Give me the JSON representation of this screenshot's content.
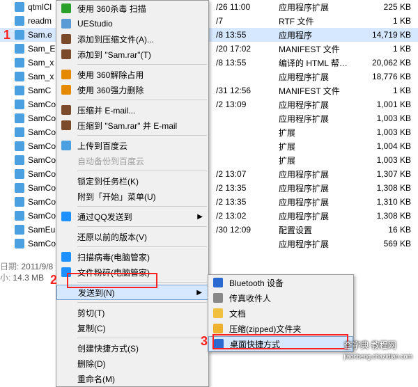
{
  "files": [
    {
      "name": "qtmlCl",
      "date": "/26 11:00",
      "type": "应用程序扩展",
      "size": "225 KB"
    },
    {
      "name": "readm",
      "date": "/7",
      "type": "RTF 文件",
      "size": "1 KB"
    },
    {
      "name": "Sam.e",
      "date": "/8 13:55",
      "type": "应用程序",
      "size": "14,719 KB",
      "sel": true
    },
    {
      "name": "Sam_E",
      "date": "/20 17:02",
      "type": "MANIFEST 文件",
      "size": "1 KB"
    },
    {
      "name": "Sam_x",
      "date": "/8 13:55",
      "type": "编译的 HTML 帮…",
      "size": "20,062 KB"
    },
    {
      "name": "Sam_x",
      "date": "",
      "type": "应用程序扩展",
      "size": "18,776 KB"
    },
    {
      "name": "SamC",
      "date": "/31 12:56",
      "type": "MANIFEST 文件",
      "size": "1 KB"
    },
    {
      "name": "SamCo",
      "date": "/2 13:09",
      "type": "应用程序扩展",
      "size": "1,001 KB"
    },
    {
      "name": "SamCo",
      "date": "",
      "type": "应用程序扩展",
      "size": "1,003 KB"
    },
    {
      "name": "SamCo",
      "date": "",
      "type": "扩展",
      "size": "1,003 KB"
    },
    {
      "name": "SamCo",
      "date": "",
      "type": "扩展",
      "size": "1,004 KB"
    },
    {
      "name": "SamCo",
      "date": "",
      "type": "扩展",
      "size": "1,003 KB"
    },
    {
      "name": "SamCo",
      "date": "/2 13:07",
      "type": "应用程序扩展",
      "size": "1,307 KB"
    },
    {
      "name": "SamCo",
      "date": "/2 13:35",
      "type": "应用程序扩展",
      "size": "1,308 KB"
    },
    {
      "name": "SamCo",
      "date": "/2 13:35",
      "type": "应用程序扩展",
      "size": "1,310 KB"
    },
    {
      "name": "SamCo",
      "date": "/2 13:02",
      "type": "应用程序扩展",
      "size": "1,308 KB"
    },
    {
      "name": "SamEu",
      "date": "/30 12:09",
      "type": "配置设置",
      "size": "16 KB"
    },
    {
      "name": "SamCo",
      "date": "",
      "type": "应用程序扩展",
      "size": "569 KB"
    }
  ],
  "menu1": [
    {
      "label": "使用 360杀毒 扫描",
      "icon": "shield"
    },
    {
      "label": "UEStudio",
      "icon": "ue"
    },
    {
      "label": "添加到压缩文件(A)...",
      "icon": "rar"
    },
    {
      "label": "添加到 \"Sam.rar\"(T)",
      "icon": "rar"
    },
    {
      "sep": true
    },
    {
      "label": "使用 360解除占用",
      "icon": "360"
    },
    {
      "label": "使用 360强力删除",
      "icon": "360"
    },
    {
      "sep": true
    },
    {
      "label": "压缩并 E-mail...",
      "icon": "rar"
    },
    {
      "label": "压缩到 \"Sam.rar\" 并 E-mail",
      "icon": "rar"
    },
    {
      "sep": true
    },
    {
      "label": "上传到百度云",
      "icon": "cloud"
    },
    {
      "label": "自动备份到百度云",
      "disabled": true
    },
    {
      "sep": true
    },
    {
      "label": "锁定到任务栏(K)"
    },
    {
      "label": "附到「开始」菜单(U)"
    },
    {
      "sep": true
    },
    {
      "label": "通过QQ发送到",
      "icon": "qq",
      "arrow": true
    },
    {
      "sep": true
    },
    {
      "label": "还原以前的版本(V)"
    },
    {
      "sep": true
    },
    {
      "label": "扫描病毒(电脑管家)",
      "icon": "guard"
    },
    {
      "label": "文件粉碎(电脑管家)",
      "icon": "guard"
    },
    {
      "sep": true
    },
    {
      "label": "发送到(N)",
      "arrow": true,
      "hover": true
    },
    {
      "sep": true
    },
    {
      "label": "剪切(T)"
    },
    {
      "label": "复制(C)"
    },
    {
      "sep": true
    },
    {
      "label": "创建快捷方式(S)"
    },
    {
      "label": "删除(D)"
    },
    {
      "label": "重命名(M)"
    }
  ],
  "menu2": [
    {
      "label": "Bluetooth 设备",
      "icon": "bt"
    },
    {
      "label": "传真收件人",
      "icon": "fax"
    },
    {
      "label": "文档",
      "icon": "folder"
    },
    {
      "label": "压缩(zipped)文件夹",
      "icon": "zip"
    },
    {
      "label": "桌面快捷方式",
      "icon": "desk",
      "hover": true
    }
  ],
  "status": {
    "date_label": "日期:",
    "date": "2011/9/8",
    "size_label": "小:",
    "size": "14.3 MB"
  },
  "badges": {
    "b1": "1",
    "b2": "2",
    "b3": "3"
  },
  "water": {
    "big": "查字典",
    "small": "jiaocheng.chazidian.com",
    "mid": "教程网"
  }
}
